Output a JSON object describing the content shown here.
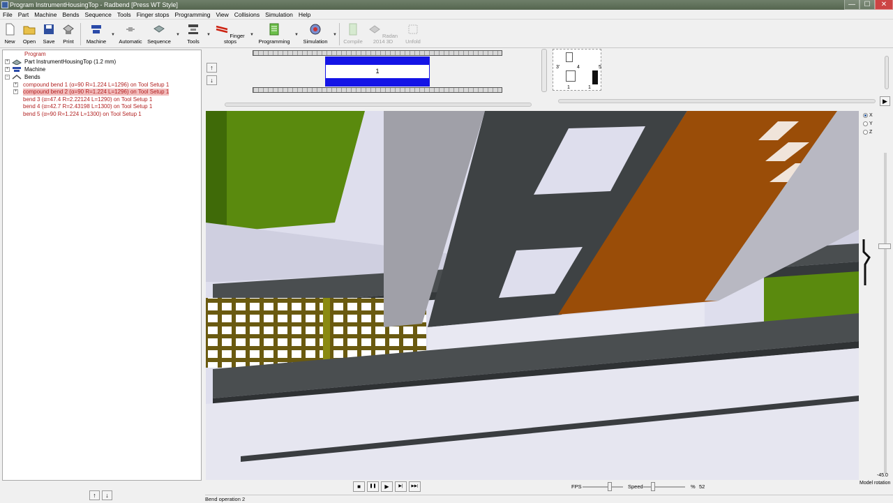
{
  "window": {
    "title": "Program InstrumentHousingTop - Radbend [Press WT Style]",
    "minimize": "—",
    "maximize": "☐",
    "close": "✕"
  },
  "menu": [
    "File",
    "Part",
    "Machine",
    "Bends",
    "Sequence",
    "Tools",
    "Finger stops",
    "Programming",
    "View",
    "Collisions",
    "Simulation",
    "Help"
  ],
  "toolbar": {
    "new": "New",
    "open": "Open",
    "save": "Save",
    "print": "Print",
    "machine": "Machine",
    "automatic": "Automatic",
    "sequence": "Sequence",
    "tools": "Tools",
    "finger_stops": "Finger stops",
    "programming": "Programming",
    "simulation": "Simulation",
    "compile": "Compile",
    "radan": "Radan 2014 3D",
    "unfold": "Unfold"
  },
  "tree": {
    "root": "Program",
    "part": "Part InstrumentHousingTop (1.2 mm)",
    "machine": "Machine",
    "bends": "Bends",
    "items": [
      "compound bend 1 (α=90 R=1.224 L=1296) on Tool Setup 1",
      "compound bend 2 (α=90 R=1.224 L=1296) on Tool Setup 1",
      "bend 3 (α=47.4 R=2.22124 L=1290) on Tool Setup 1",
      "bend 4 (α=42.7 R=2.43198 L=1300) on Tool Setup 1",
      "bend 5 (α=90 R=1.224 L=1300) on Tool Setup 1"
    ]
  },
  "tool_setup": {
    "station_label": "1",
    "profile_labels": [
      "3'",
      "4",
      "5",
      "1",
      "1"
    ]
  },
  "axes": {
    "x": "X",
    "y": "Y",
    "z": "Z"
  },
  "playback": {
    "stop": "■",
    "pause": "❚❚",
    "play": "▶",
    "step": "▶|",
    "end": "▶▶|",
    "fps_label": "FPS",
    "speed_label": "Speed",
    "percent": "%",
    "speed_value": "52"
  },
  "rotation": {
    "value": "-45.0",
    "label": "Model rotation"
  },
  "status": "Bend operation 2",
  "nav": {
    "up": "↑",
    "down": "↓",
    "right": "▶"
  },
  "colors": {
    "accent_blue": "#1414e6",
    "selected_red": "#b22222",
    "sheet_orange": "#9a4d08",
    "frame_dark": "#3e4244",
    "machine_green": "#5a8a0e"
  }
}
